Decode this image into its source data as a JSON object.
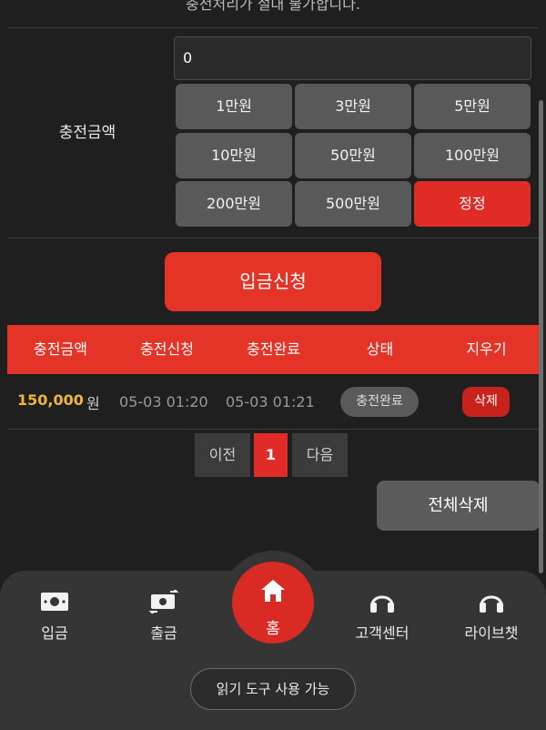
{
  "notice": "충전처리가 절대 불가합니다.",
  "form": {
    "amount_label": "충전금액",
    "amount_value": "0",
    "amount_buttons": [
      "1만원",
      "3만원",
      "5만원",
      "10만원",
      "50만원",
      "100만원",
      "200만원",
      "500만원",
      "정정"
    ],
    "apply_label": "입금신청"
  },
  "table": {
    "headers": [
      "충전금액",
      "충전신청",
      "충전완료",
      "상태",
      "지우기"
    ],
    "rows": [
      {
        "amount": "150,000",
        "unit": "원",
        "requested": "05-03 01:20",
        "completed": "05-03 01:21",
        "status": "충전완료",
        "delete": "삭제"
      }
    ]
  },
  "pagination": {
    "prev": "이전",
    "current": "1",
    "next": "다음"
  },
  "delete_all_label": "전체삭제",
  "bottom_nav": {
    "items": [
      {
        "label": "입금",
        "icon": "cash-icon"
      },
      {
        "label": "출금",
        "icon": "cash-exchange-icon"
      },
      {
        "label": "홈",
        "icon": "home-icon"
      },
      {
        "label": "고객센터",
        "icon": "headset-icon"
      },
      {
        "label": "라이브챗",
        "icon": "headset-icon"
      }
    ]
  },
  "reader_label": "읽기 도구 사용 가능",
  "colors": {
    "accent": "#e33427",
    "amount": "#f0b53a",
    "background": "#1f1f1f"
  }
}
